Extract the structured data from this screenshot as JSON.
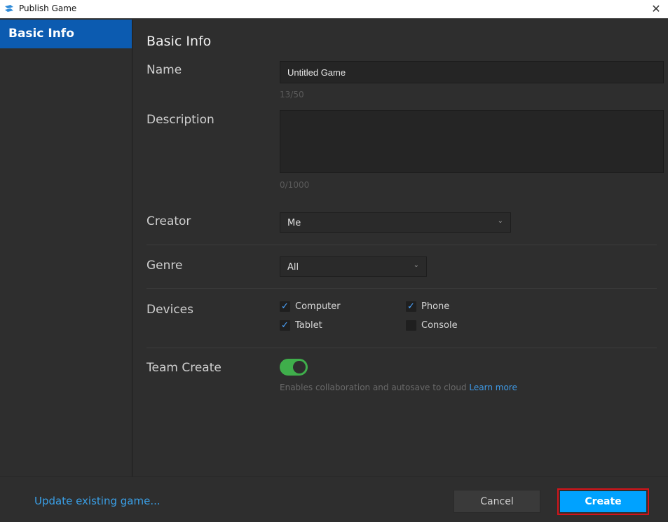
{
  "window": {
    "title": "Publish Game",
    "close_icon": "close-icon"
  },
  "sidebar": {
    "items": [
      {
        "label": "Basic Info",
        "active": true
      }
    ]
  },
  "main": {
    "heading": "Basic Info",
    "name": {
      "label": "Name",
      "value": "Untitled Game",
      "counter": "13/50"
    },
    "description": {
      "label": "Description",
      "value": "",
      "counter": "0/1000"
    },
    "creator": {
      "label": "Creator",
      "selected": "Me"
    },
    "genre": {
      "label": "Genre",
      "selected": "All"
    },
    "devices": {
      "label": "Devices",
      "options": [
        {
          "label": "Computer",
          "checked": true
        },
        {
          "label": "Phone",
          "checked": true
        },
        {
          "label": "Tablet",
          "checked": true
        },
        {
          "label": "Console",
          "checked": false
        }
      ]
    },
    "team_create": {
      "label": "Team Create",
      "enabled": true,
      "hint": "Enables collaboration and autosave to cloud ",
      "link": "Learn more"
    }
  },
  "footer": {
    "update_link": "Update existing game...",
    "cancel_label": "Cancel",
    "create_label": "Create"
  },
  "colors": {
    "accent": "#00a2ff",
    "sidebar_active": "#0c5bb0",
    "toggle_on": "#3fae4b",
    "highlight_border": "#d3141a",
    "link": "#3a9fe6"
  },
  "checkmark_glyph": "✓",
  "chevron_glyph": "⌄"
}
